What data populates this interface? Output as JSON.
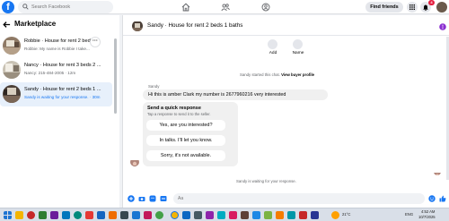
{
  "topbar": {
    "logo_letter": "f",
    "search_placeholder": "Search Facebook",
    "find_friends_label": "Find friends",
    "notification_count": "4"
  },
  "sidebar": {
    "title": "Marketplace",
    "conversations": [
      {
        "title": "Robbie · House for rent 2 bed...",
        "subtitle": "Robbie: My name is Robbie I take..."
      },
      {
        "title": "Nancy · House for rent 3 beds 2 ...",
        "subtitle": "Nancy: 215-484-2005 · 12m"
      },
      {
        "title": "Sandy · House for rent 2 beds 1 ...",
        "subtitle": "Sandy is waiting for your response. · 30m"
      }
    ]
  },
  "chat": {
    "title": "Sandy · House for rent 2 beds 1 baths",
    "quick_actions": [
      "Add",
      "Name"
    ],
    "started_text": "Sandy started this chat.",
    "view_profile_label": "View buyer profile",
    "sender_name": "Sandy",
    "message": "Hi this is amber Clark my number is 2677960216 very interested",
    "quick_reply": {
      "title": "Send a quick response",
      "subtitle": "Tap a response to send it to the seller.",
      "options": [
        "Yes, are you interested?",
        "In talks. I'll let you know.",
        "Sorry, it's not available."
      ]
    },
    "waiting_text": "Sandy is waiting for your response.",
    "composer_placeholder": "Aa"
  },
  "taskbar": {
    "weather": "21°C",
    "language": "ENG",
    "time": "4:52 AM",
    "date": "10/7/2025"
  },
  "colors": {
    "facebook_blue": "#1877f2",
    "notification_red": "#e41e3f",
    "active_row": "#e7f0fb"
  },
  "icons": {
    "nav": [
      "home-icon",
      "friends-icon",
      "groups-icon"
    ],
    "top_right": [
      "menu-grid-icon",
      "messenger-icon",
      "notifications-icon"
    ],
    "composer": [
      "plus-circle-icon",
      "camera-icon",
      "sticker-icon",
      "gif-icon",
      "emoji-icon",
      "thumbs-up-icon"
    ]
  }
}
